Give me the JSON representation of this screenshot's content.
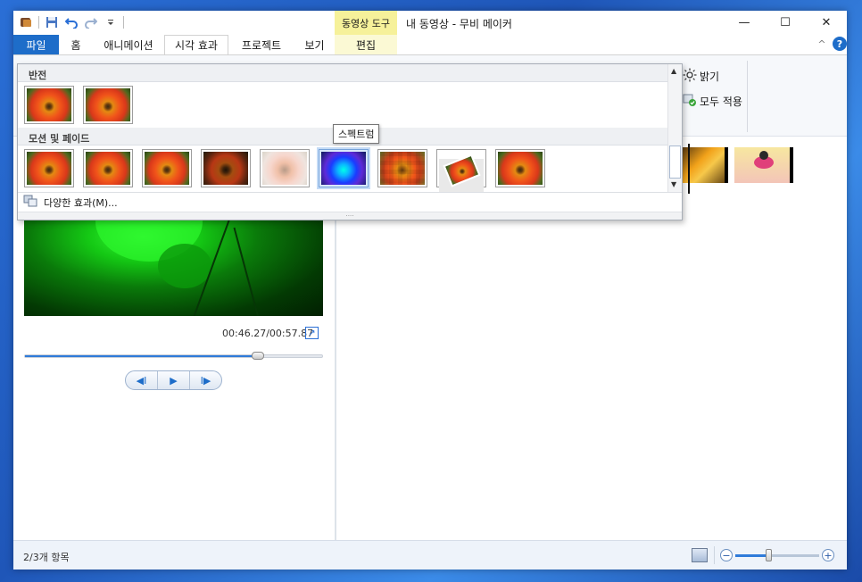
{
  "titlebar": {
    "context_group": "동영상 도구",
    "doc_title": "내 동영상 - 무비 메이커",
    "minimize": "—",
    "maximize": "☐",
    "close": "✕"
  },
  "tabs": {
    "file": "파일",
    "home": "홈",
    "animation": "애니메이션",
    "visual_effects": "시각 효과",
    "project": "프로젝트",
    "view": "보기",
    "edit": "편집",
    "help": "?",
    "collapse": "^"
  },
  "ribbon": {
    "brightness": "밝기",
    "apply_all": "모두 적용"
  },
  "gallery": {
    "section_invert": "반전",
    "section_motion": "모션 및 페이드",
    "more_effects": "다양한 효과(M)...",
    "tooltip": "스펙트럼",
    "grip": "····",
    "invert_items": [
      "normal",
      "normal"
    ],
    "motion_items": [
      "normal",
      "normal",
      "normal",
      "dark",
      "fade",
      "spectrum",
      "pixelate",
      "tilt",
      "normal"
    ],
    "selected_index": 5
  },
  "player": {
    "timecode": "00:46.27/00:57.87",
    "progress_fraction": 0.78,
    "prev_frame": "◀I",
    "play": "▶",
    "next_frame": "I▶"
  },
  "statusbar": {
    "item_count": "2/3개 항목",
    "zoom_fraction": 0.4,
    "zoom_out": "−",
    "zoom_in": "+"
  },
  "colors": {
    "accent": "#1e6dc9",
    "context_tab": "#f6f19a",
    "status_bg": "#eef3fa"
  }
}
